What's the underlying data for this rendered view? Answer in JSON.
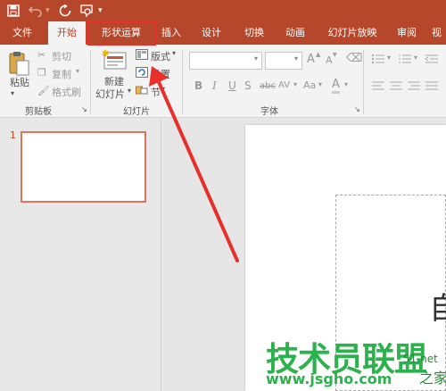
{
  "tabs": [
    "文件",
    "开始",
    "形状运算",
    "插入",
    "设计",
    "切换",
    "动画",
    "幻灯片放映",
    "审阅",
    "视"
  ],
  "ribbon": {
    "paste_label": "粘贴",
    "cut_label": "剪切",
    "copy_label": "复制",
    "format_painter_label": "格式刷",
    "clipboard_group": "剪贴板",
    "new_slide_line1": "新建",
    "new_slide_line2": "幻灯片",
    "layout_label": "版式",
    "reset_label": "重置",
    "section_label": "节",
    "slides_group": "幻灯片",
    "font_group": "字体",
    "bold": "B",
    "italic": "I",
    "underline": "U",
    "strikethrough": "S",
    "strike_text": "abc",
    "spacing": "AV",
    "change_case": "Aa",
    "grow_font": "A",
    "shrink_font": "A",
    "font_color": "A",
    "shadow_s": "S"
  },
  "thumbnails": {
    "slide_number": "1"
  },
  "slide": {
    "visible_char": "自"
  },
  "watermark": {
    "brand": "技术员联盟",
    "url": "www.jsgho.com",
    "side_text": "51.net",
    "side_text2": "之家"
  },
  "colors": {
    "accent": "#b7472a",
    "highlight_box": "#e8302b",
    "arrow": "#e8302b",
    "watermark_green": "#2bb24c"
  },
  "icons": [
    "save-icon",
    "undo-icon",
    "redo-icon",
    "presenter-icon"
  ]
}
